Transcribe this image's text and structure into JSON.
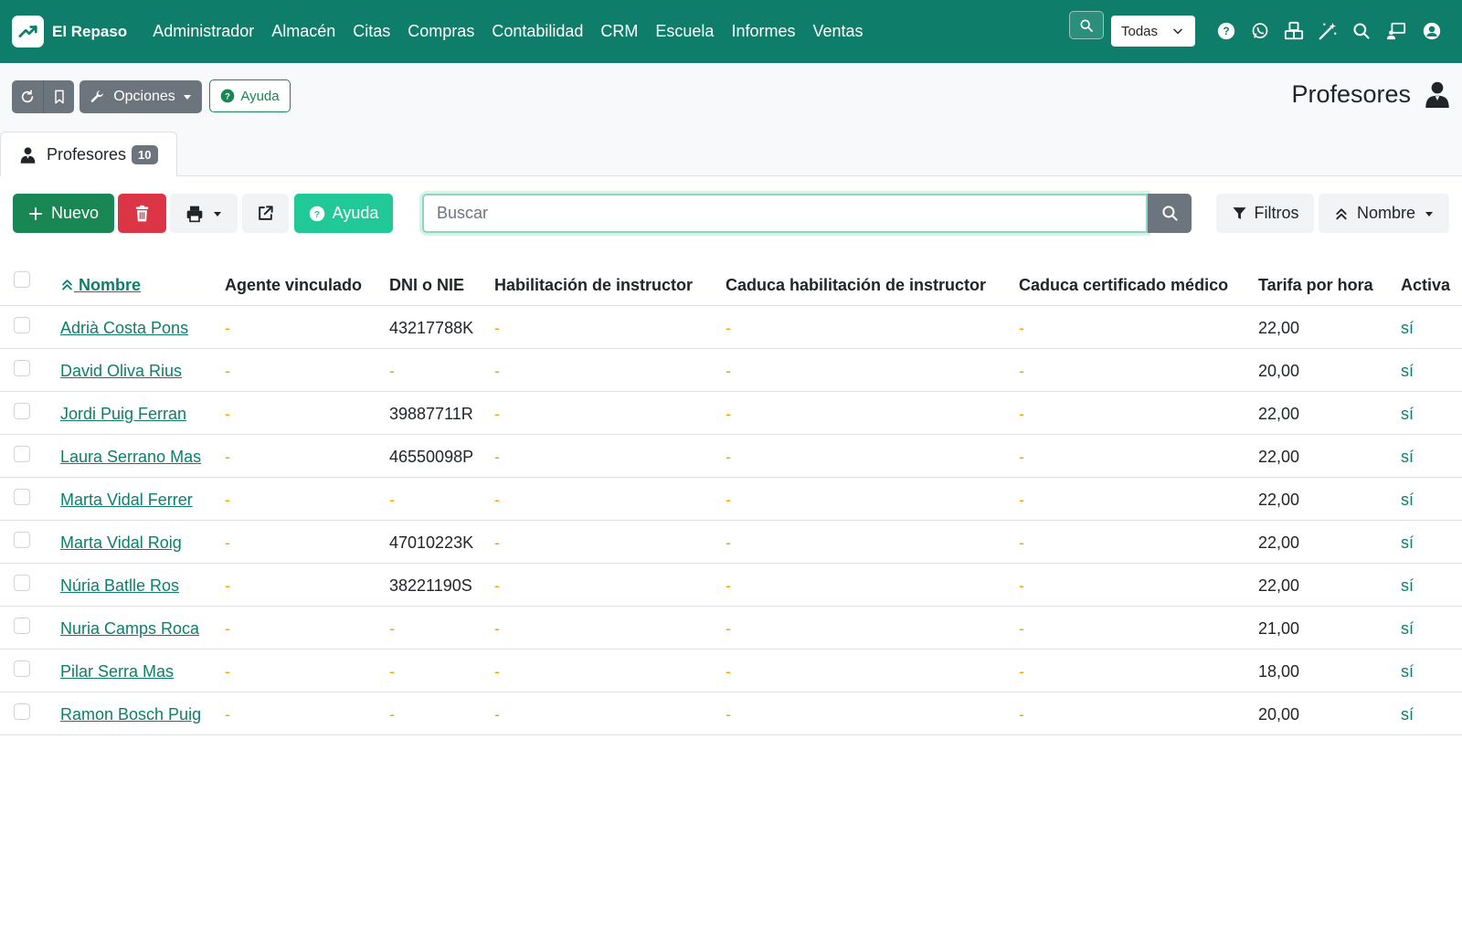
{
  "navbar": {
    "brand": "El Repaso",
    "menu": [
      "Administrador",
      "Almacén",
      "Citas",
      "Compras",
      "Contabilidad",
      "CRM",
      "Escuela",
      "Informes",
      "Ventas"
    ],
    "company_select": "Todas",
    "color": "#0e7e6a",
    "icons": [
      "search-icon",
      "help-icon",
      "whatsapp-icon",
      "cubes-icon",
      "magic-wand-icon",
      "search-icon",
      "chalkboard-user-icon",
      "user-circle-icon"
    ]
  },
  "actionbar": {
    "options_label": "Opciones",
    "help_label": "Ayuda",
    "page_title": "Profesores"
  },
  "tab": {
    "label": "Profesores",
    "count": "10"
  },
  "toolbar": {
    "new_label": "Nuevo",
    "help_label": "Ayuda",
    "search_placeholder": "Buscar",
    "filters_label": "Filtros",
    "order_label": "Nombre"
  },
  "table": {
    "headers": [
      "Nombre",
      "Agente vinculado",
      "DNI o NIE",
      "Habilitación de instructor",
      "Caduca habilitación de instructor",
      "Caduca certificado médico",
      "Tarifa por hora",
      "Activa"
    ],
    "rows": [
      {
        "nombre": "Adrià Costa Pons",
        "agente": "-",
        "dni": "43217788K",
        "habilitacion": "-",
        "caduca_hab": "-",
        "caduca_cert": "-",
        "tarifa": "22,00",
        "activa": "sí"
      },
      {
        "nombre": "David Oliva Rius",
        "agente": "-",
        "dni": "-",
        "habilitacion": "-",
        "caduca_hab": "-",
        "caduca_cert": "-",
        "tarifa": "20,00",
        "activa": "sí"
      },
      {
        "nombre": "Jordi Puig Ferran",
        "agente": "-",
        "dni": "39887711R",
        "habilitacion": "-",
        "caduca_hab": "-",
        "caduca_cert": "-",
        "tarifa": "22,00",
        "activa": "sí"
      },
      {
        "nombre": "Laura Serrano Mas",
        "agente": "-",
        "dni": "46550098P",
        "habilitacion": "-",
        "caduca_hab": "-",
        "caduca_cert": "-",
        "tarifa": "22,00",
        "activa": "sí"
      },
      {
        "nombre": "Marta Vidal Ferrer",
        "agente": "-",
        "dni": "-",
        "habilitacion": "-",
        "caduca_hab": "-",
        "caduca_cert": "-",
        "tarifa": "22,00",
        "activa": "sí"
      },
      {
        "nombre": "Marta Vidal Roig",
        "agente": "-",
        "dni": "47010223K",
        "habilitacion": "-",
        "caduca_hab": "-",
        "caduca_cert": "-",
        "tarifa": "22,00",
        "activa": "sí"
      },
      {
        "nombre": "Núria Batlle Ros",
        "agente": "-",
        "dni": "38221190S",
        "habilitacion": "-",
        "caduca_hab": "-",
        "caduca_cert": "-",
        "tarifa": "22,00",
        "activa": "sí"
      },
      {
        "nombre": "Nuria Camps Roca",
        "agente": "-",
        "dni": "-",
        "habilitacion": "-",
        "caduca_hab": "-",
        "caduca_cert": "-",
        "tarifa": "21,00",
        "activa": "sí"
      },
      {
        "nombre": "Pilar Serra Mas",
        "agente": "-",
        "dni": "-",
        "habilitacion": "-",
        "caduca_hab": "-",
        "caduca_cert": "-",
        "tarifa": "18,00",
        "activa": "sí"
      },
      {
        "nombre": "Ramon Bosch Puig",
        "agente": "-",
        "dni": "-",
        "habilitacion": "-",
        "caduca_hab": "-",
        "caduca_cert": "-",
        "tarifa": "20,00",
        "activa": "sí"
      }
    ]
  }
}
